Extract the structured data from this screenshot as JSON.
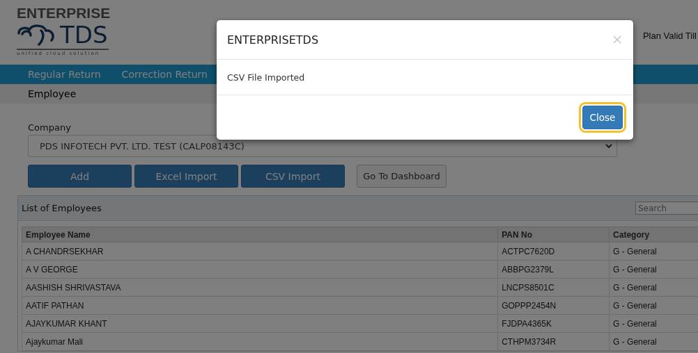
{
  "header": {
    "logo": {
      "top": "ENTERPRISE",
      "main": "TDS",
      "tagline": "unified cloud solution"
    },
    "plan_text": "Plan Valid Till"
  },
  "nav": {
    "items": [
      "Regular Return",
      "Correction Return"
    ]
  },
  "breadcrumb": "Employee",
  "company": {
    "label": "Company",
    "value": "PDS INFOTECH PVT. LTD. TEST (CALP08143C)"
  },
  "buttons": [
    {
      "label": "Add",
      "kind": "primary"
    },
    {
      "label": "Excel Import",
      "kind": "primary"
    },
    {
      "label": "CSV Import",
      "kind": "primary"
    },
    {
      "label": "Go To Dashboard",
      "kind": "secondary"
    }
  ],
  "employees": {
    "title": "List of Employees",
    "search": {
      "placeholder": "Search"
    },
    "columns": [
      "Employee Name",
      "PAN No",
      "Category"
    ],
    "rows": [
      [
        "A CHANDRSEKHAR",
        "ACTPC7620D",
        "G - General"
      ],
      [
        "A V GEORGE",
        "ABBPG2379L",
        "G - General"
      ],
      [
        "AASHISH SHRIVASTAVA",
        "LNCPS8501C",
        "G - General"
      ],
      [
        "AATIF PATHAN",
        "GOPPP2454N",
        "G - General"
      ],
      [
        "AJAYKUMAR KHANT",
        "FJDPA4365K",
        "G - General"
      ],
      [
        "Ajaykumar Mali",
        "CTHPM3734R",
        "G - General"
      ]
    ]
  },
  "dialog": {
    "title": "ENTERPRISETDS",
    "message": "CSV File Imported",
    "button": {
      "label": "Close",
      "focused": true
    }
  }
}
